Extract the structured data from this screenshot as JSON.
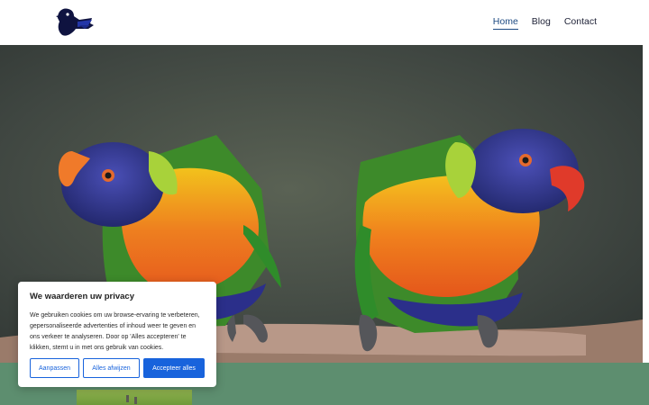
{
  "header": {
    "logo_icon": "crow-bird-logo-icon",
    "nav": [
      {
        "label": "Home",
        "active": true
      },
      {
        "label": "Blog",
        "active": false
      },
      {
        "label": "Contact",
        "active": false
      }
    ]
  },
  "hero": {
    "image": "two-rainbow-lorikeets-on-branch"
  },
  "cookie_banner": {
    "title": "We waarderen uw privacy",
    "text": "We gebruiken cookies om uw browse-ervaring te verbeteren, gepersonaliseerde advertenties of inhoud weer te geven en ons verkeer te analyseren. Door op 'Alles accepteren' te klikken, stemt u in met ons gebruik van cookies.",
    "customize_label": "Aanpassen",
    "reject_label": "Alles afwijzen",
    "accept_label": "Accepteer alles"
  },
  "colors": {
    "accent": "#1863dc",
    "section_green": "#5d8e6f",
    "nav_active": "#1d4a82"
  }
}
